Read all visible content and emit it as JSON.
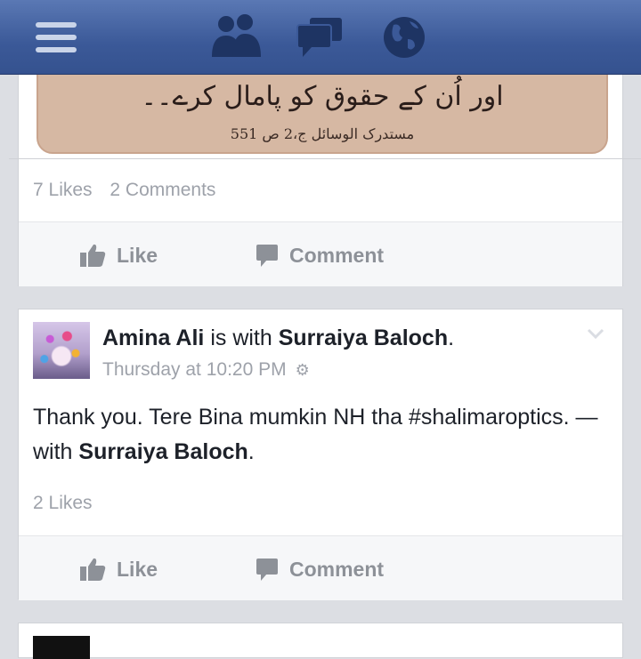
{
  "nav": {
    "icons": [
      "menu-icon",
      "friends-icon",
      "messages-icon",
      "globe-icon"
    ],
    "colors": {
      "bar": "#3b5998",
      "icon": "#c9d4e9"
    }
  },
  "posts": [
    {
      "image_text": {
        "main": "اور اُن کے حقوق کو پامال کرے۔۔",
        "sub": "مستدرک الوسائل ج،2 ص 551"
      },
      "likes": "7 Likes",
      "comments": "2 Comments",
      "like_label": "Like",
      "comment_label": "Comment"
    },
    {
      "author": "Amina Ali",
      "with_text": " is with ",
      "tagged": "Surraiya Baloch",
      "period": ".",
      "time": "Thursday at 10:20 PM",
      "body_text": "Thank you. Tere Bina mumkin NH tha #shalimaroptics. — with ",
      "body_tag": "Surraiya Baloch",
      "body_end": ".",
      "likes": "2 Likes",
      "like_label": "Like",
      "comment_label": "Comment"
    }
  ]
}
